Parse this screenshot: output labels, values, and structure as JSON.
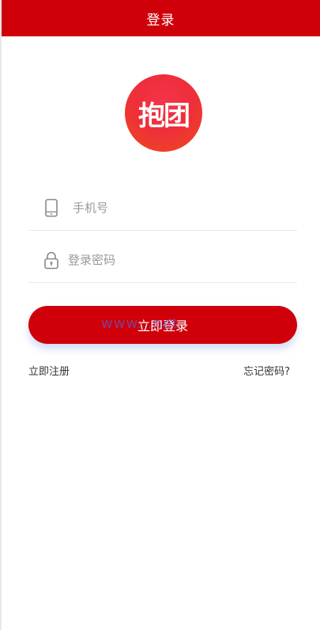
{
  "header": {
    "title": "登录"
  },
  "logo": {
    "text": "抱团"
  },
  "form": {
    "phone": {
      "placeholder": "手机号",
      "value": "",
      "icon": "phone-icon"
    },
    "password": {
      "placeholder": "登录密码",
      "value": "",
      "icon": "lock-icon"
    },
    "login_label": "立即登录"
  },
  "watermark": "www.   .net",
  "links": {
    "register": "立即注册",
    "forgot": "忘记密码?"
  },
  "colors": {
    "brand": "#d0000a",
    "logo_start": "#f5334a",
    "logo_end": "#ef4a1f",
    "placeholder": "#999999"
  }
}
